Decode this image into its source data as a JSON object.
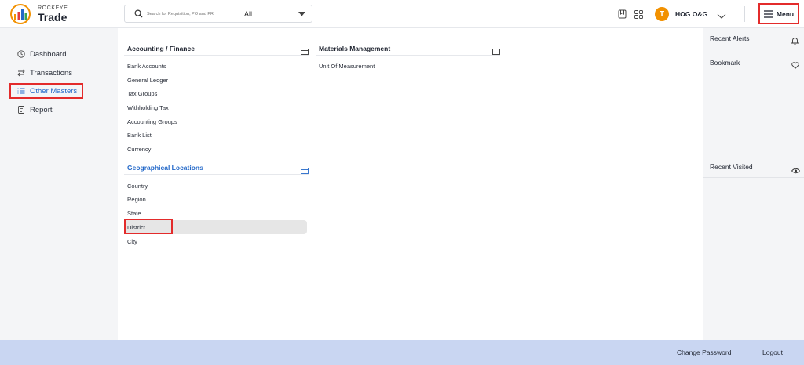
{
  "brand": {
    "small": "ROCKEYE",
    "big": "Trade",
    "colors": {
      "accent": "#f29100",
      "active": "#2469c9",
      "highlight": "#e32b2b"
    }
  },
  "header": {
    "search_placeholder": "Search for Requisition, PO and PR",
    "search_scope": "All",
    "avatar_letter": "T",
    "org_name": "HOG O&G",
    "menu_label": "Menu",
    "icons": [
      "bookmark-icon",
      "apps-grid-icon",
      "chevron-down-icon",
      "hamburger-icon"
    ]
  },
  "sidebar": {
    "items": [
      {
        "label": "Dashboard",
        "icon": "clock-icon",
        "active": false
      },
      {
        "label": "Transactions",
        "icon": "arrows-icon",
        "active": false
      },
      {
        "label": "Other Masters",
        "icon": "list-icon",
        "active": true
      },
      {
        "label": "Report",
        "icon": "document-icon",
        "active": false
      }
    ]
  },
  "main": {
    "accounting": {
      "title": "Accounting / Finance",
      "items": [
        "Bank Accounts",
        "General Ledger",
        "Tax Groups",
        "Withholding Tax",
        "Accounting Groups",
        "Bank List",
        "Currency"
      ]
    },
    "materials": {
      "title": "Materials Management",
      "items": [
        "Unit Of Measurement"
      ]
    },
    "geo": {
      "title": "Geographical Locations",
      "items": [
        "Country",
        "Region",
        "State",
        "District",
        "City"
      ]
    }
  },
  "right_panel": {
    "recent_alerts": "Recent Alerts",
    "bookmark": "Bookmark",
    "recent_visited": "Recent Visited"
  },
  "footer": {
    "change_password": "Change Password",
    "logout": "Logout"
  }
}
